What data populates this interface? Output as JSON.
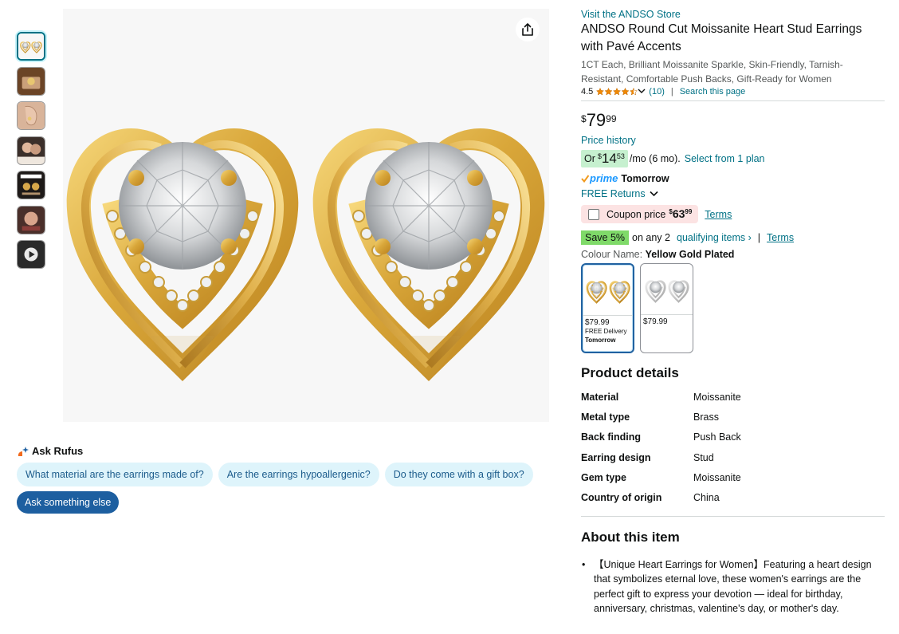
{
  "icons": {
    "share": "share-icon",
    "rufus": "rufus-spark-icon",
    "star": "star-icon",
    "chevron": "chevron-down-icon",
    "prime_check": "prime-check-icon",
    "play": "play-icon"
  },
  "colors": {
    "link": "#007185",
    "prime": "#1a98ff",
    "star": "#f08804",
    "save_badge": "#7fda69",
    "monthly_badge": "#c6f0cf",
    "coupon_bg": "#fce3e3",
    "chip_bg": "#def4fb",
    "ask_button": "#1d5fa0"
  },
  "rufus": {
    "title": "Ask Rufus",
    "chips": [
      "What material are the earrings made of?",
      "Are the earrings hypoallergenic?",
      "Do they come with a gift box?"
    ],
    "ask_else": "Ask something else"
  },
  "product": {
    "store_link": "Visit the ANDSO Store",
    "title": "ANDSO Round Cut Moissanite Heart Stud Earrings with Pavé Accents",
    "subtitle": "1CT Each, Brilliant Moissanite Sparkle, Skin-Friendly, Tarnish-Resistant, Comfortable Push Backs, Gift-Ready for Women",
    "rating": "4.5",
    "rating_value": 4.5,
    "review_count": "(10)",
    "search_page": "Search this page"
  },
  "price": {
    "symbol": "$",
    "whole": "79",
    "fraction": "99",
    "history": "Price history",
    "monthly_or": "Or",
    "monthly_symbol": "$",
    "monthly_whole": "14",
    "monthly_fraction": "53",
    "monthly_suffix": "/mo (6 mo).",
    "plan_link": "Select from 1 plan"
  },
  "delivery": {
    "prime": "prime",
    "day": "Tomorrow",
    "returns": "FREE Returns"
  },
  "coupon": {
    "label": "Coupon price",
    "symbol": "$",
    "whole": "63",
    "fraction": "99",
    "terms": "Terms"
  },
  "save": {
    "badge": "Save 5%",
    "on_any": "on any 2",
    "link": "qualifying items ›",
    "separator": "|",
    "terms": "Terms"
  },
  "colour": {
    "label": "Colour Name:",
    "selected": "Yellow Gold Plated",
    "swatches": [
      {
        "price": "$79.99",
        "delivery": "FREE Delivery",
        "day": "Tomorrow"
      },
      {
        "price": "$79.99"
      }
    ]
  },
  "details": {
    "title": "Product details",
    "rows": [
      {
        "key": "Material",
        "value": "Moissanite"
      },
      {
        "key": "Metal type",
        "value": "Brass"
      },
      {
        "key": "Back finding",
        "value": "Push Back"
      },
      {
        "key": "Earring design",
        "value": "Stud"
      },
      {
        "key": "Gem type",
        "value": "Moissanite"
      },
      {
        "key": "Country of origin",
        "value": "China"
      }
    ]
  },
  "about": {
    "title": "About this item",
    "bullets": [
      "【Unique Heart Earrings for Women】Featuring a heart design that symbolizes eternal love, these women's earrings are the perfect gift to express your devotion — ideal for birthday, anniversary, christmas, valentine's day, or mother's day."
    ]
  }
}
